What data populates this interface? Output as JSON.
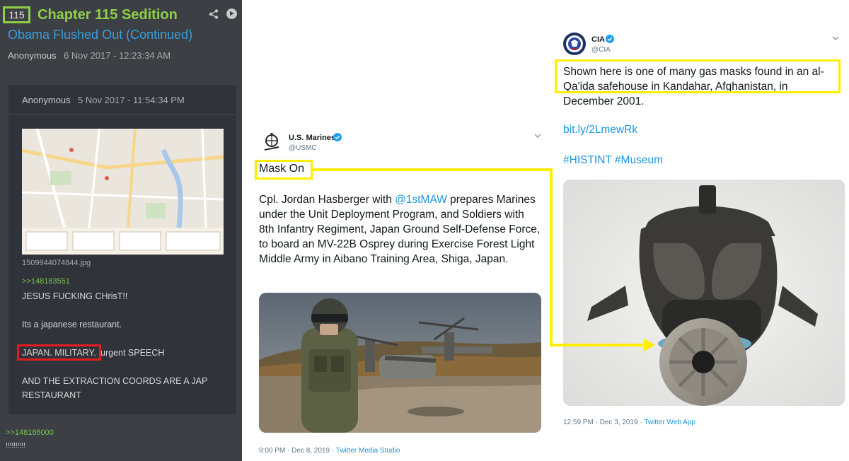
{
  "left_post": {
    "chapter_number": "115",
    "chapter_title": "Chapter 115 Sedition",
    "subtitle": "Obama Flushed Out (Continued)",
    "author": "Anonymous",
    "date": "6 Nov 2017 - 12:23:34 AM",
    "inner": {
      "author": "Anonymous",
      "date": "5 Nov 2017 - 11:54:34 PM",
      "filename": "1509944074844.jpg",
      "reply_link": ">>148183551",
      "lines": [
        "JESUS FUCKING CHrisT!!",
        "Its a japanese restaurant.",
        "JAPAN. MILITARY.",
        "urgent SPEECH",
        "AND THE EXTRACTION COORDS ARE A JAP",
        "RESTAURANT"
      ]
    },
    "bottom_link": ">>148186000",
    "bottom_text": "!!!!!!!!!!"
  },
  "tweet_marines": {
    "name": "U.S. Marines",
    "handle": "@USMC",
    "headline": "Mask On",
    "body_pre": " Cpl. Jordan Hasberger with ",
    "mention": "@1stMAW",
    "body_post": " prepares Marines under the Unit Deployment Program, and Soldiers with 8th Infantry Regiment, Japan Ground Self-Defense Force, to board an MV-22B Osprey during Exercise Forest Light Middle Army in Aibano Training Area, Shiga, Japan.",
    "timestamp": "9:00 PM · Dec 8, 2019 · ",
    "source": "Twitter Media Studio"
  },
  "tweet_cia": {
    "name": "CIA",
    "handle": "@CIA",
    "text": "Shown here is one of many gas masks found in an al-Qa'ida safehouse in Kandahar, Afghanistan, in December 2001.",
    "link": "bit.ly/2LmewRk",
    "tags": "#HISTINT #Museum",
    "timestamp": "12:59 PM · Dec 3, 2019 · ",
    "source": "Twitter Web App"
  },
  "colors": {
    "highlight_yellow": "#ffee00",
    "highlight_red": "#e01e1e",
    "accent_green": "#8fcf47",
    "link_blue": "#1b95e0",
    "panel_dark": "#3c3f44"
  }
}
